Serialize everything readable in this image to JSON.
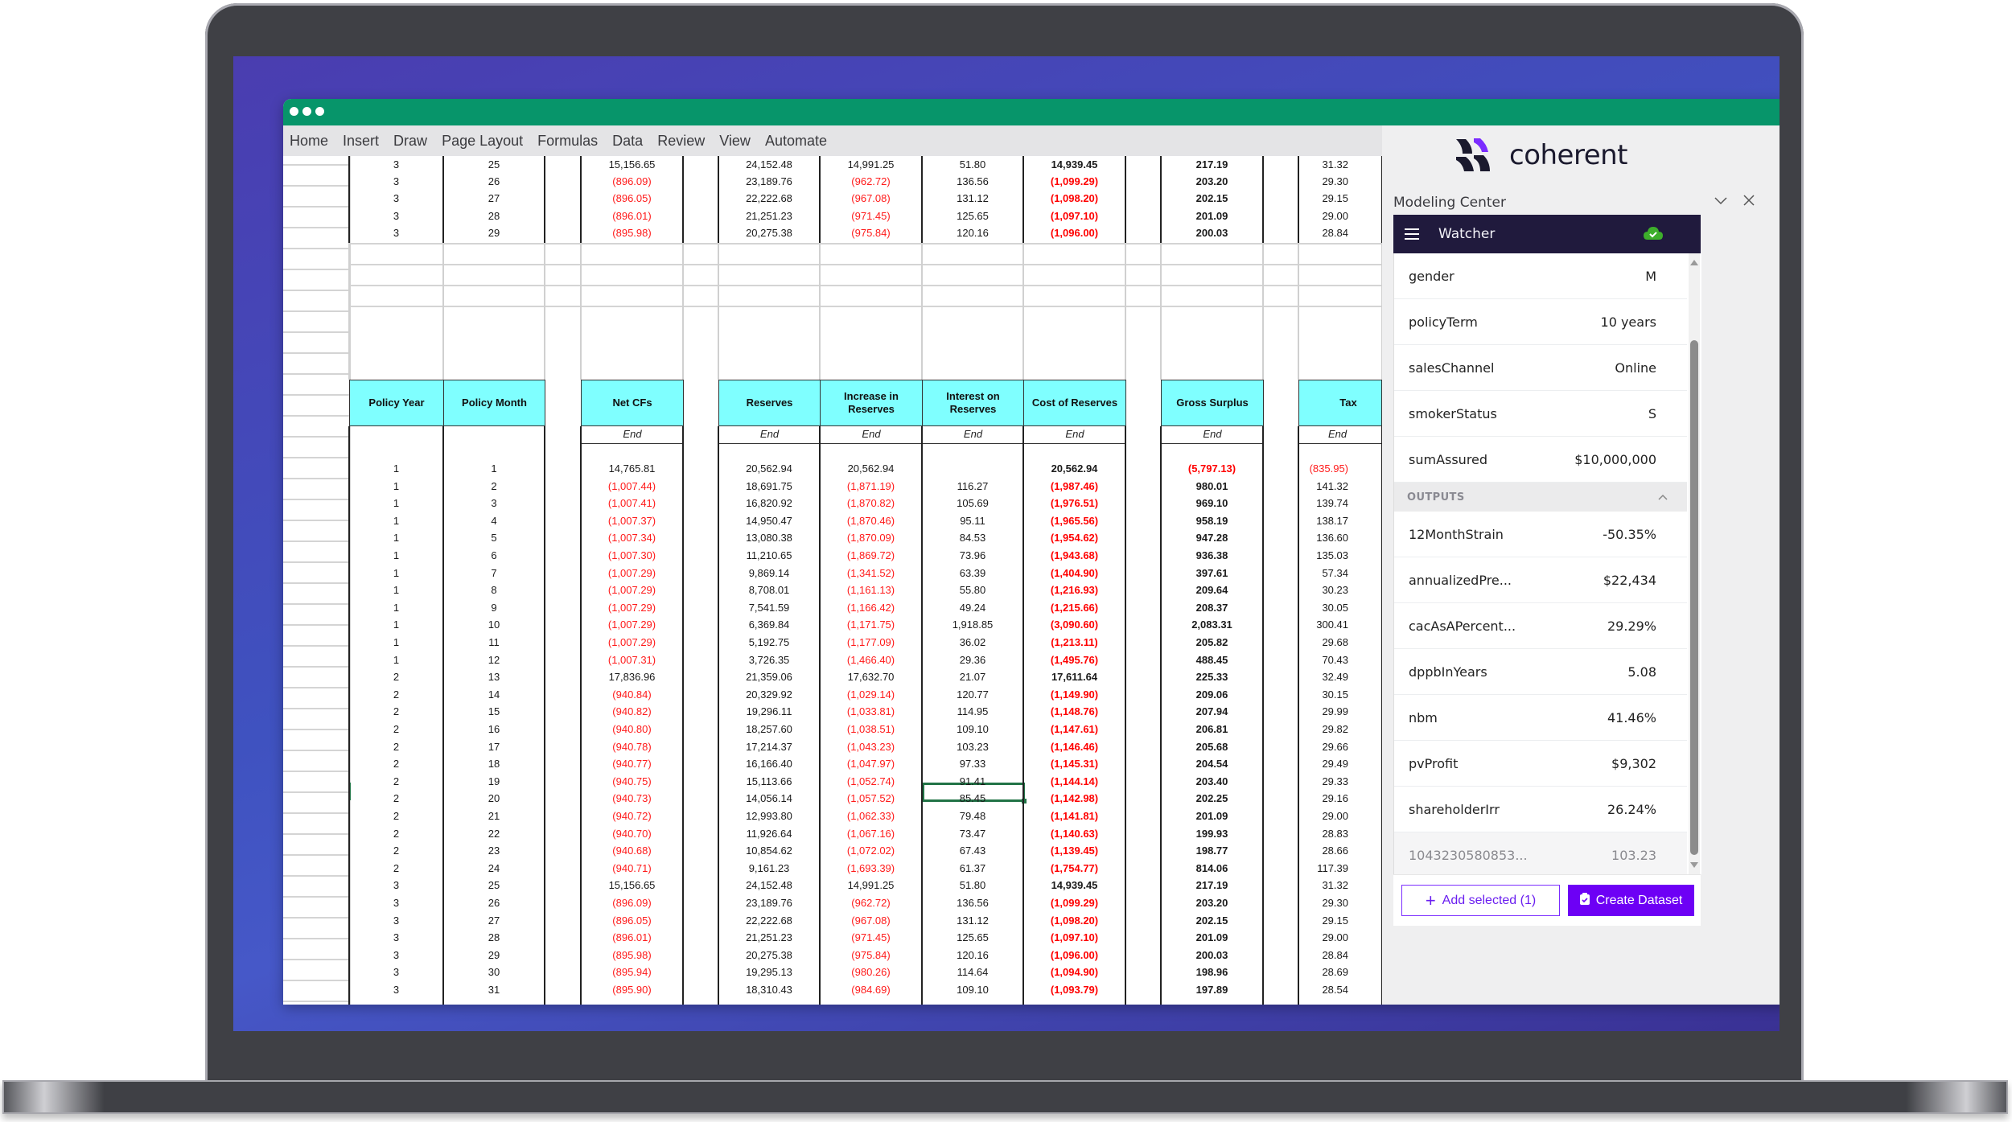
{
  "menu": [
    "Home",
    "Insert",
    "Draw",
    "Page Layout",
    "Formulas",
    "Data",
    "Review",
    "View",
    "Automate"
  ],
  "sheet": {
    "headers": {
      "policy_year": "Policy Year",
      "policy_month": "Policy Month",
      "net_cfs": "Net CFs",
      "reserves": "Reserves",
      "increase_in_reserves": "Increase in Reserves",
      "interest_on_reserves": "Interest on Reserves",
      "cost_of_reserves": "Cost of Reserves",
      "gross_surplus": "Gross Surplus",
      "tax": "Tax"
    },
    "end_label": "End",
    "top_rows": [
      [
        "3",
        "25",
        "15,156.65",
        "24,152.48",
        "14,991.25",
        "51.80",
        "14,939.45",
        "217.19",
        "31.32"
      ],
      [
        "3",
        "26",
        "(896.09)",
        "23,189.76",
        "(962.72)",
        "136.56",
        "(1,099.29)",
        "203.20",
        "29.30"
      ],
      [
        "3",
        "27",
        "(896.05)",
        "22,222.68",
        "(967.08)",
        "131.12",
        "(1,098.20)",
        "202.15",
        "29.15"
      ],
      [
        "3",
        "28",
        "(896.01)",
        "21,251.23",
        "(971.45)",
        "125.65",
        "(1,097.10)",
        "201.09",
        "29.00"
      ],
      [
        "3",
        "29",
        "(895.98)",
        "20,275.38",
        "(975.84)",
        "120.16",
        "(1,096.00)",
        "200.03",
        "28.84"
      ]
    ],
    "rows": [
      [
        "1",
        "1",
        "14,765.81",
        "20,562.94",
        "20,562.94",
        "",
        "20,562.94",
        "(5,797.13)",
        "(835.95)"
      ],
      [
        "1",
        "2",
        "(1,007.44)",
        "18,691.75",
        "(1,871.19)",
        "116.27",
        "(1,987.46)",
        "980.01",
        "141.32"
      ],
      [
        "1",
        "3",
        "(1,007.41)",
        "16,820.92",
        "(1,870.82)",
        "105.69",
        "(1,976.51)",
        "969.10",
        "139.74"
      ],
      [
        "1",
        "4",
        "(1,007.37)",
        "14,950.47",
        "(1,870.46)",
        "95.11",
        "(1,965.56)",
        "958.19",
        "138.17"
      ],
      [
        "1",
        "5",
        "(1,007.34)",
        "13,080.38",
        "(1,870.09)",
        "84.53",
        "(1,954.62)",
        "947.28",
        "136.60"
      ],
      [
        "1",
        "6",
        "(1,007.30)",
        "11,210.65",
        "(1,869.72)",
        "73.96",
        "(1,943.68)",
        "936.38",
        "135.03"
      ],
      [
        "1",
        "7",
        "(1,007.29)",
        "9,869.14",
        "(1,341.52)",
        "63.39",
        "(1,404.90)",
        "397.61",
        "57.34"
      ],
      [
        "1",
        "8",
        "(1,007.29)",
        "8,708.01",
        "(1,161.13)",
        "55.80",
        "(1,216.93)",
        "209.64",
        "30.23"
      ],
      [
        "1",
        "9",
        "(1,007.29)",
        "7,541.59",
        "(1,166.42)",
        "49.24",
        "(1,215.66)",
        "208.37",
        "30.05"
      ],
      [
        "1",
        "10",
        "(1,007.29)",
        "6,369.84",
        "(1,171.75)",
        "1,918.85",
        "(3,090.60)",
        "2,083.31",
        "300.41"
      ],
      [
        "1",
        "11",
        "(1,007.29)",
        "5,192.75",
        "(1,177.09)",
        "36.02",
        "(1,213.11)",
        "205.82",
        "29.68"
      ],
      [
        "1",
        "12",
        "(1,007.31)",
        "3,726.35",
        "(1,466.40)",
        "29.36",
        "(1,495.76)",
        "488.45",
        "70.43"
      ],
      [
        "2",
        "13",
        "17,836.96",
        "21,359.06",
        "17,632.70",
        "21.07",
        "17,611.64",
        "225.33",
        "32.49"
      ],
      [
        "2",
        "14",
        "(940.84)",
        "20,329.92",
        "(1,029.14)",
        "120.77",
        "(1,149.90)",
        "209.06",
        "30.15"
      ],
      [
        "2",
        "15",
        "(940.82)",
        "19,296.11",
        "(1,033.81)",
        "114.95",
        "(1,148.76)",
        "207.94",
        "29.99"
      ],
      [
        "2",
        "16",
        "(940.80)",
        "18,257.60",
        "(1,038.51)",
        "109.10",
        "(1,147.61)",
        "206.81",
        "29.82"
      ],
      [
        "2",
        "17",
        "(940.78)",
        "17,214.37",
        "(1,043.23)",
        "103.23",
        "(1,146.46)",
        "205.68",
        "29.66"
      ],
      [
        "2",
        "18",
        "(940.77)",
        "16,166.40",
        "(1,047.97)",
        "97.33",
        "(1,145.31)",
        "204.54",
        "29.49"
      ],
      [
        "2",
        "19",
        "(940.75)",
        "15,113.66",
        "(1,052.74)",
        "91.41",
        "(1,144.14)",
        "203.40",
        "29.33"
      ],
      [
        "2",
        "20",
        "(940.73)",
        "14,056.14",
        "(1,057.52)",
        "85.45",
        "(1,142.98)",
        "202.25",
        "29.16"
      ],
      [
        "2",
        "21",
        "(940.72)",
        "12,993.80",
        "(1,062.33)",
        "79.48",
        "(1,141.81)",
        "201.09",
        "29.00"
      ],
      [
        "2",
        "22",
        "(940.70)",
        "11,926.64",
        "(1,067.16)",
        "73.47",
        "(1,140.63)",
        "199.93",
        "28.83"
      ],
      [
        "2",
        "23",
        "(940.68)",
        "10,854.62",
        "(1,072.02)",
        "67.43",
        "(1,139.45)",
        "198.77",
        "28.66"
      ],
      [
        "2",
        "24",
        "(940.71)",
        "9,161.23",
        "(1,693.39)",
        "61.37",
        "(1,754.77)",
        "814.06",
        "117.39"
      ],
      [
        "3",
        "25",
        "15,156.65",
        "24,152.48",
        "14,991.25",
        "51.80",
        "14,939.45",
        "217.19",
        "31.32"
      ],
      [
        "3",
        "26",
        "(896.09)",
        "23,189.76",
        "(962.72)",
        "136.56",
        "(1,099.29)",
        "203.20",
        "29.30"
      ],
      [
        "3",
        "27",
        "(896.05)",
        "22,222.68",
        "(967.08)",
        "131.12",
        "(1,098.20)",
        "202.15",
        "29.15"
      ],
      [
        "3",
        "28",
        "(896.01)",
        "21,251.23",
        "(971.45)",
        "125.65",
        "(1,097.10)",
        "201.09",
        "29.00"
      ],
      [
        "3",
        "29",
        "(895.98)",
        "20,275.38",
        "(975.84)",
        "120.16",
        "(1,096.00)",
        "200.03",
        "28.84"
      ],
      [
        "3",
        "30",
        "(895.94)",
        "19,295.13",
        "(980.26)",
        "114.64",
        "(1,094.90)",
        "198.96",
        "28.69"
      ],
      [
        "3",
        "31",
        "(895.90)",
        "18,310.43",
        "(984.69)",
        "109.10",
        "(1,093.79)",
        "197.89",
        "28.54"
      ]
    ],
    "selected_cell": {
      "row_month": "17",
      "column": "Interest on Reserves",
      "value": "103.23"
    }
  },
  "panel": {
    "brand": "coherent",
    "title": "Modeling Center",
    "watcher_label": "Watcher",
    "status_icon": "cloud-check-icon",
    "status_color": "#3dae2b",
    "accent_color": "#6d00f5",
    "inputs": [
      {
        "name": "gender",
        "value": "M"
      },
      {
        "name": "policyTerm",
        "value": "10 years"
      },
      {
        "name": "salesChannel",
        "value": "Online"
      },
      {
        "name": "smokerStatus",
        "value": "S"
      },
      {
        "name": "sumAssured",
        "value": "$10,000,000"
      }
    ],
    "outputs_label": "OUTPUTS",
    "outputs": [
      {
        "name": "12MonthStrain",
        "value": "-50.35%"
      },
      {
        "name": "annualizedPre...",
        "value": "$22,434"
      },
      {
        "name": "cacAsAPercent...",
        "value": "29.29%"
      },
      {
        "name": "dppbInYears",
        "value": "5.08"
      },
      {
        "name": "nbm",
        "value": "41.46%"
      },
      {
        "name": "pvProfit",
        "value": "$9,302"
      },
      {
        "name": "shareholderIrr",
        "value": "26.24%"
      }
    ],
    "selected_ref": {
      "name": "1043230580853...",
      "value": "103.23"
    },
    "add_selected_label": "Add selected (1)",
    "create_dataset_label": "Create Dataset"
  }
}
